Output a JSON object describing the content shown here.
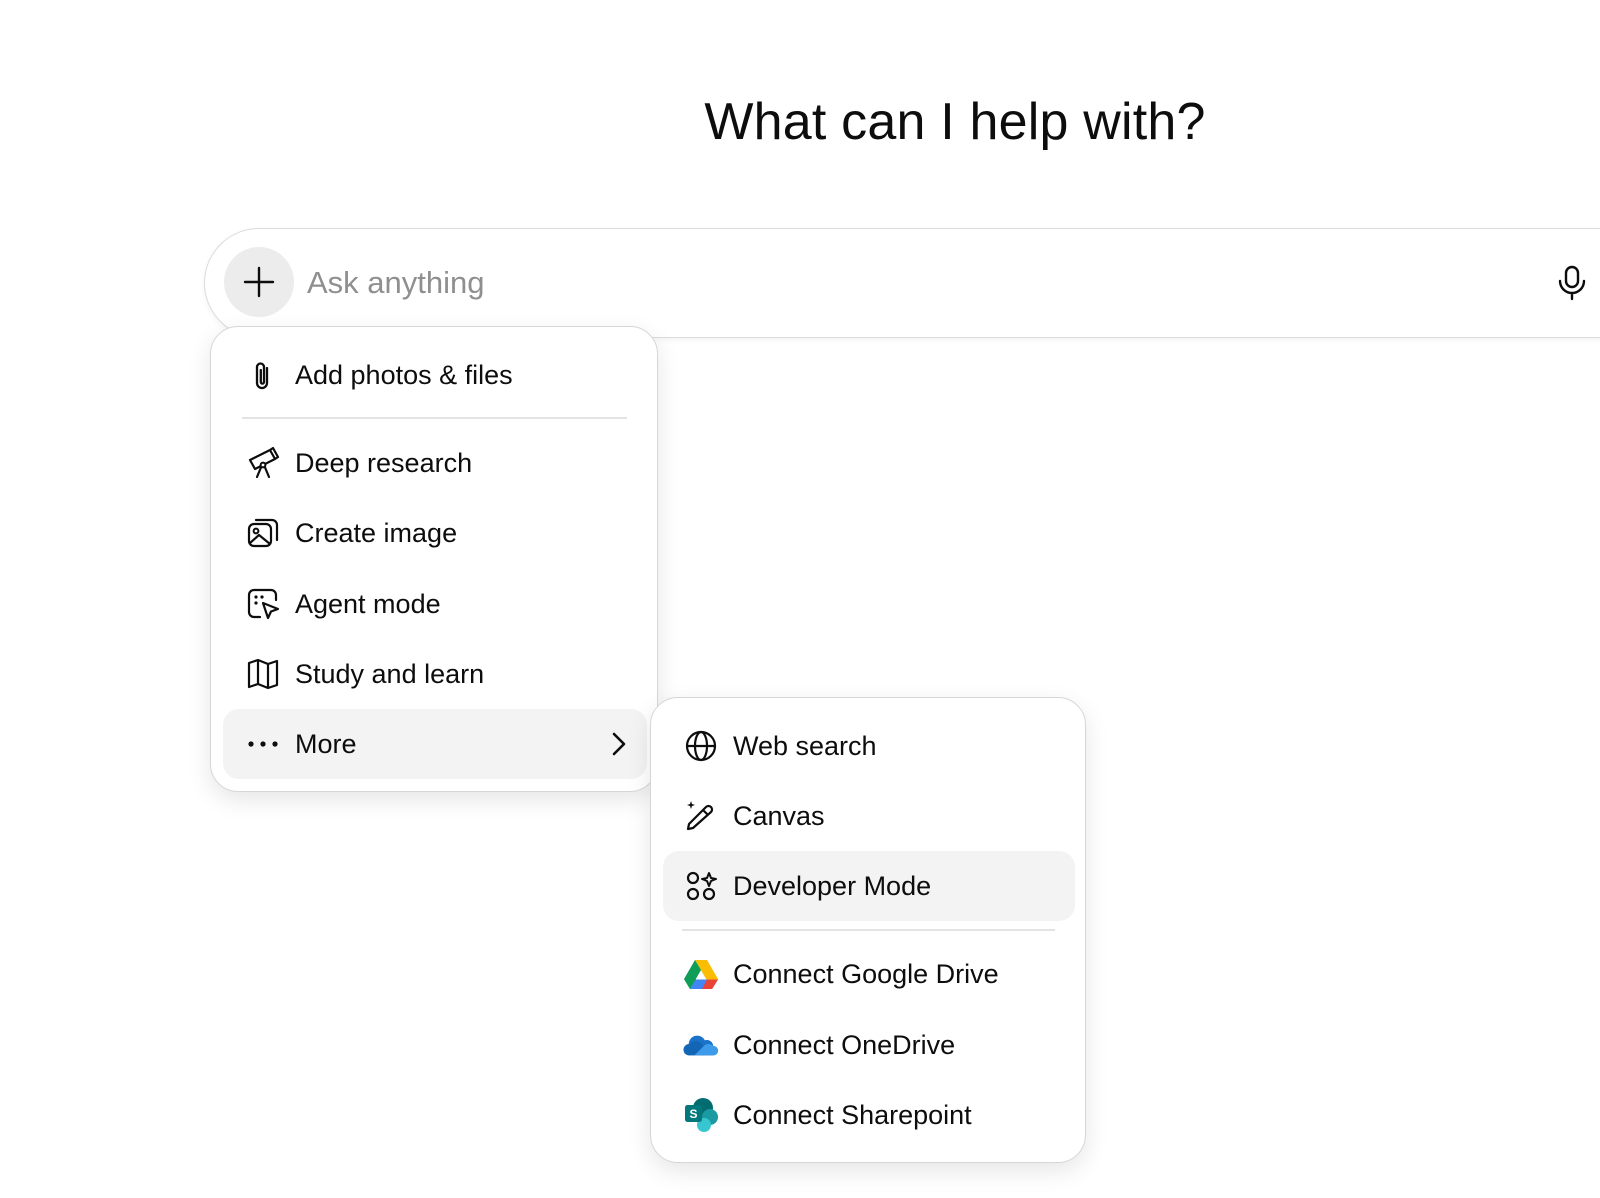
{
  "heading": "What can I help with?",
  "composer": {
    "placeholder": "Ask anything"
  },
  "menu": {
    "items": [
      {
        "label": "Add photos & files",
        "icon": "paperclip-icon"
      },
      {
        "label": "Deep research",
        "icon": "telescope-icon"
      },
      {
        "label": "Create image",
        "icon": "image-icon"
      },
      {
        "label": "Agent mode",
        "icon": "agent-cursor-icon"
      },
      {
        "label": "Study and learn",
        "icon": "book-icon"
      },
      {
        "label": "More",
        "icon": "ellipsis-icon"
      }
    ]
  },
  "submenu": {
    "items": [
      {
        "label": "Web search",
        "icon": "globe-icon"
      },
      {
        "label": "Canvas",
        "icon": "pencil-sparkle-icon"
      },
      {
        "label": "Developer Mode",
        "icon": "developer-icon"
      },
      {
        "label": "Connect Google Drive",
        "icon": "google-drive-icon"
      },
      {
        "label": "Connect OneDrive",
        "icon": "onedrive-icon"
      },
      {
        "label": "Connect Sharepoint",
        "icon": "sharepoint-icon"
      }
    ]
  },
  "colors": {
    "text": "#0d0d0d",
    "placeholder": "#8f8f8f",
    "active_bg": "#f3f3f3",
    "plus_bg": "#ececec"
  }
}
